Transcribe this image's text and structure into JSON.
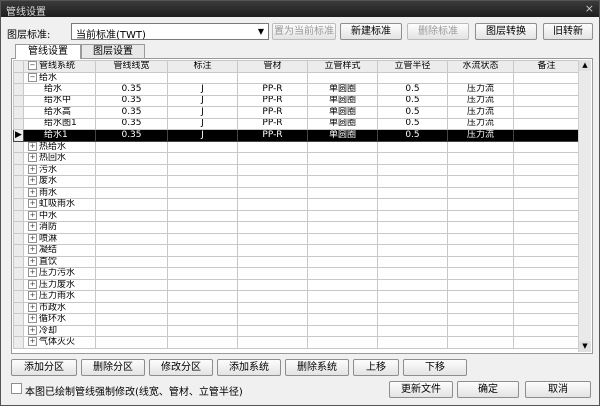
{
  "window": {
    "title": "管线设置",
    "close_glyph": "×"
  },
  "toolbar": {
    "layer_standard_label": "图层标准:",
    "layer_standard_value": "当前标准(TWT)",
    "set_current_label": "置为当前标准",
    "new_standard_label": "新建标准",
    "delete_standard_label": "删除标准",
    "layer_convert_label": "图层转换",
    "old_convert_label": "旧转新"
  },
  "tabs": [
    {
      "label": "管线设置"
    },
    {
      "label": "图层设置"
    }
  ],
  "table": {
    "columns": [
      "管线系统",
      "管线线宽",
      "标注",
      "管材",
      "立管样式",
      "立管半径",
      "水流状态",
      "备注"
    ],
    "rows": [
      {
        "expander": "−",
        "system": "给水",
        "width": "",
        "mark": "",
        "material": "",
        "style": "",
        "radius": "",
        "flow": "",
        "note": "",
        "level": 0
      },
      {
        "expander": "",
        "system": "给水",
        "width": "0.35",
        "mark": "J",
        "material": "PP-R",
        "style": "单圆圈",
        "radius": "0.5",
        "flow": "压力流",
        "note": "",
        "level": 1
      },
      {
        "expander": "",
        "system": "给水中",
        "width": "0.35",
        "mark": "J",
        "material": "PP-R",
        "style": "单圆圈",
        "radius": "0.5",
        "flow": "压力流",
        "note": "",
        "level": 1
      },
      {
        "expander": "",
        "system": "给水高",
        "width": "0.35",
        "mark": "J",
        "material": "PP-R",
        "style": "单圆圈",
        "radius": "0.5",
        "flow": "压力流",
        "note": "",
        "level": 1
      },
      {
        "expander": "",
        "system": "给水图1",
        "width": "0.35",
        "mark": "J",
        "material": "PP-R",
        "style": "单圆圈",
        "radius": "0.5",
        "flow": "压力流",
        "note": "",
        "level": 1
      },
      {
        "expander": "",
        "system": "给水1",
        "width": "0.35",
        "mark": "J",
        "material": "PP-R",
        "style": "单圆圈",
        "radius": "0.5",
        "flow": "压力流",
        "note": "",
        "level": 1,
        "selected": true
      },
      {
        "expander": "+",
        "system": "热给水",
        "level": 0
      },
      {
        "expander": "+",
        "system": "热回水",
        "level": 0
      },
      {
        "expander": "+",
        "system": "污水",
        "level": 0
      },
      {
        "expander": "+",
        "system": "废水",
        "level": 0
      },
      {
        "expander": "+",
        "system": "雨水",
        "level": 0
      },
      {
        "expander": "+",
        "system": "虹吸雨水",
        "level": 0
      },
      {
        "expander": "+",
        "system": "中水",
        "level": 0
      },
      {
        "expander": "+",
        "system": "消防",
        "level": 0
      },
      {
        "expander": "+",
        "system": "喷淋",
        "level": 0
      },
      {
        "expander": "+",
        "system": "凝结",
        "level": 0
      },
      {
        "expander": "+",
        "system": "直饮",
        "level": 0
      },
      {
        "expander": "+",
        "system": "压力污水",
        "level": 0
      },
      {
        "expander": "+",
        "system": "压力废水",
        "level": 0
      },
      {
        "expander": "+",
        "system": "压力雨水",
        "level": 0
      },
      {
        "expander": "+",
        "system": "市政水",
        "level": 0
      },
      {
        "expander": "+",
        "system": "循环水",
        "level": 0
      },
      {
        "expander": "+",
        "system": "冷却",
        "level": 0
      },
      {
        "expander": "+",
        "system": "气体灭火",
        "level": 0
      }
    ],
    "selected_marker": "▶"
  },
  "actions": {
    "add_section": "添加分区",
    "delete_section": "删除分区",
    "modify_section": "修改分区",
    "add_system": "添加系统",
    "delete_system": "删除系统",
    "move_up": "上移",
    "move_down": "下移"
  },
  "footer": {
    "force_modify_label": "本图已绘制管线强制修改(线宽、管材、立管半径)",
    "update_file": "更新文件",
    "ok": "确定",
    "cancel": "取消"
  }
}
